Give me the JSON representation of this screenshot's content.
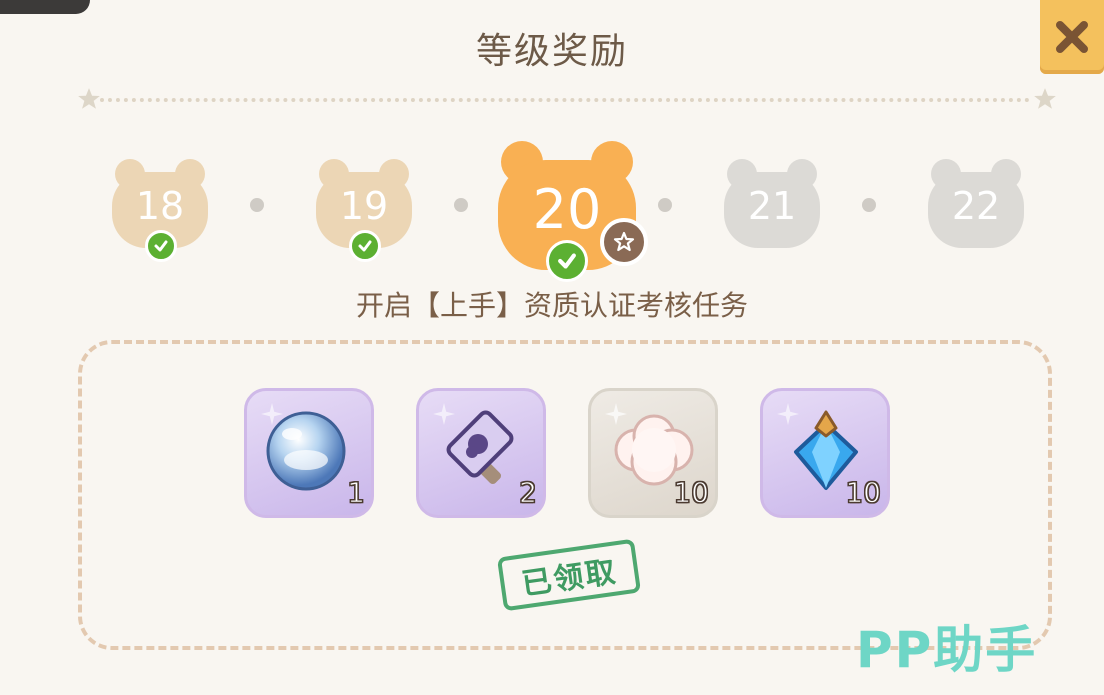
{
  "window": {
    "title": "等级奖励"
  },
  "levels": [
    {
      "label": "18",
      "state": "claimed"
    },
    {
      "label": "19",
      "state": "claimed"
    },
    {
      "label": "20",
      "state": "current-claimed"
    },
    {
      "label": "21",
      "state": "locked"
    },
    {
      "label": "22",
      "state": "locked"
    }
  ],
  "reward_description": "开启【上手】资质认证考核任务",
  "rewards": [
    {
      "icon": "crystal-orb-icon",
      "count": "1"
    },
    {
      "icon": "hammer-icon",
      "count": "2"
    },
    {
      "icon": "cotton-icon",
      "count": "10"
    },
    {
      "icon": "blue-gem-icon",
      "count": "10"
    }
  ],
  "status_stamp": "已领取",
  "watermark": "PP助手",
  "colors": {
    "claimed_bear": "#ecd6b5",
    "current_bear": "#f9b053",
    "locked_bear": "#dcdad6",
    "check_green": "#5cb032",
    "close_yellow": "#f4c15d"
  }
}
